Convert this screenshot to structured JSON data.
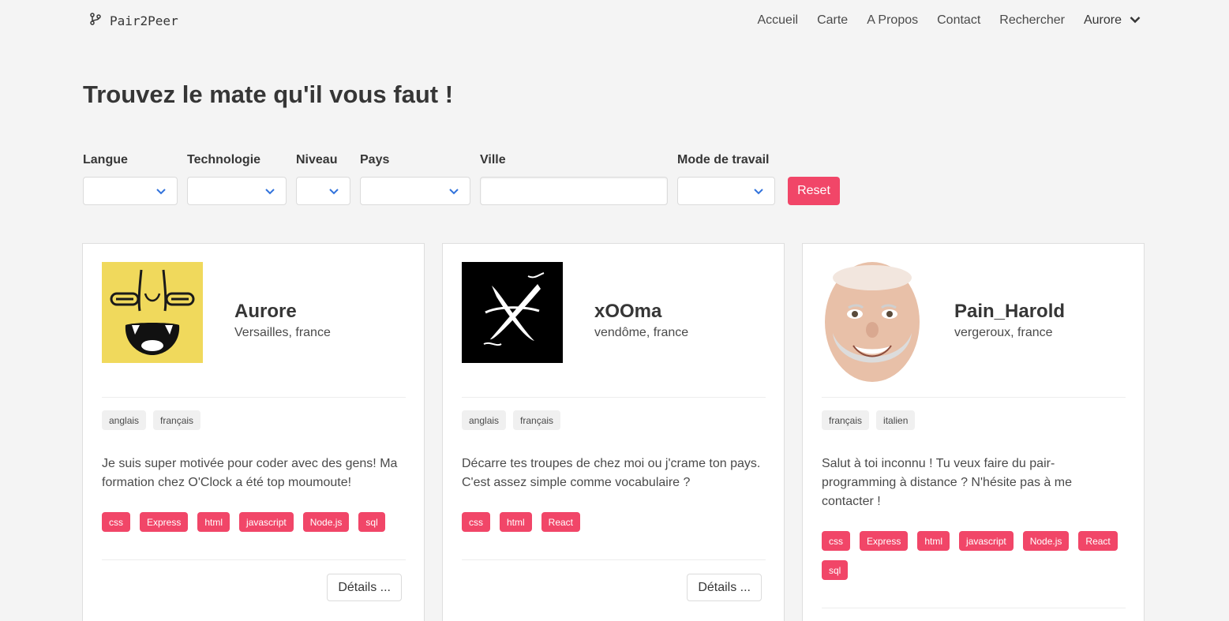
{
  "navbar": {
    "brand": "Pair2Peer",
    "links": [
      "Accueil",
      "Carte",
      "A Propos",
      "Contact",
      "Rechercher"
    ],
    "user": "Aurore"
  },
  "page_title": "Trouvez le mate qu'il vous faut !",
  "filters": {
    "langue": "Langue",
    "technologie": "Technologie",
    "niveau": "Niveau",
    "pays": "Pays",
    "ville": "Ville",
    "mode": "Mode de travail",
    "reset": "Reset"
  },
  "cards": [
    {
      "name": "Aurore",
      "location": "Versailles, france",
      "languages": [
        "anglais",
        "français"
      ],
      "description": "Je suis super motivée pour coder avec des gens! Ma formation chez O'Clock a été top moumoute!",
      "technologies": [
        "css",
        "Express",
        "html",
        "javascript",
        "Node.js",
        "sql"
      ],
      "details": "Détails ..."
    },
    {
      "name": "xOOma",
      "location": "vendôme, france",
      "languages": [
        "anglais",
        "français"
      ],
      "description": "Décarre tes troupes de chez moi ou j'crame ton pays. C'est assez simple comme vocabulaire ?",
      "technologies": [
        "css",
        "html",
        "React"
      ],
      "details": "Détails ..."
    },
    {
      "name": "Pain_Harold",
      "location": "vergeroux, france",
      "languages": [
        "français",
        "italien"
      ],
      "description": "Salut à toi inconnu ! Tu veux faire du pair-programming à distance ? N'hésite pas à me contacter !",
      "technologies": [
        "css",
        "Express",
        "html",
        "javascript",
        "Node.js",
        "React",
        "sql"
      ]
    }
  ],
  "colors": {
    "accent": "#f14668",
    "background": "#f4f4f4",
    "select_arrow": "#3273dc"
  }
}
